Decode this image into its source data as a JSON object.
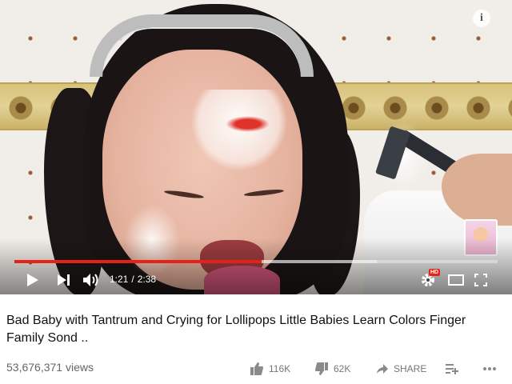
{
  "player": {
    "info_label": "i",
    "watermark": "",
    "progress": {
      "played_fraction": 0.511,
      "loaded_fraction": 0.75
    },
    "time": {
      "current": "1:21",
      "separator": "/",
      "duration": "2:38"
    },
    "hd_badge": "HD",
    "colors": {
      "progress_played": "#e62117",
      "hd_badge": "#e62117"
    }
  },
  "video": {
    "title": "Bad Baby with Tantrum and Crying for Lollipops Little Babies Learn Colors Finger Family Sond ..",
    "views": "53,676,371 views"
  },
  "actions": {
    "like": {
      "icon": "thumbs-up-icon",
      "count": "116K"
    },
    "dislike": {
      "icon": "thumbs-down-icon",
      "count": "62K"
    },
    "share": {
      "icon": "share-arrow-icon",
      "label": "SHARE"
    },
    "add_to": {
      "icon": "add-to-playlist-icon"
    },
    "more": {
      "icon": "more-horizontal-icon"
    }
  }
}
